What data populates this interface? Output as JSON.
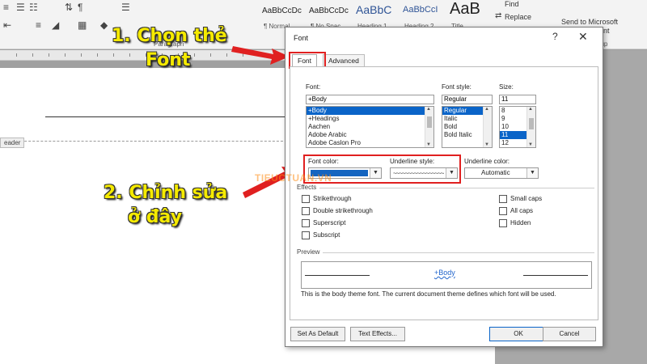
{
  "ribbon": {
    "styles": [
      {
        "sample": "AaBbCcDc",
        "name": "¶ Normal"
      },
      {
        "sample": "AaBbCcDc",
        "name": "¶ No Spac..."
      },
      {
        "sample": "AaBbC",
        "name": "Heading 1"
      },
      {
        "sample": "AaBbCcI",
        "name": "Heading 2"
      },
      {
        "sample": "AaB",
        "name": "Title"
      }
    ],
    "paragraph_label": "Paragraph",
    "find_label": "Find",
    "replace_label": "Replace",
    "send_label": "Send to Microsoft",
    "send_label2": "point",
    "group_label_right": "oup"
  },
  "document": {
    "header_tag": "eader"
  },
  "annotations": {
    "step1_line1": "1. Chọn thẻ",
    "step1_line2": "Font",
    "step2_line1": "2. Chỉnh sửa",
    "step2_line2": "ở đây",
    "watermark": "TIEUCTUAN.VN",
    "arrow_color": "#e02020",
    "text_color": "#f5ea00"
  },
  "dialog": {
    "title": "Font",
    "help": "?",
    "close": "✕",
    "tabs": {
      "font": "Font",
      "advanced": "Advanced"
    },
    "font_label": "Font:",
    "font_value": "+Body",
    "font_list": [
      "+Body",
      "+Headings",
      "Aachen",
      "Adobe Arabic",
      "Adobe Caslon Pro"
    ],
    "font_selected_index": 0,
    "style_label": "Font style:",
    "style_value": "Regular",
    "style_list": [
      "Regular",
      "Italic",
      "Bold",
      "Bold Italic"
    ],
    "style_selected_index": 0,
    "size_label": "Size:",
    "size_value": "11",
    "size_list": [
      "8",
      "9",
      "10",
      "11",
      "12"
    ],
    "size_selected_index": 3,
    "font_color_label": "Font color:",
    "font_color_value": "#1565c0",
    "underline_style_label": "Underline style:",
    "underline_style_value": "~~~~~~~~~~~~~~~~~~~~~",
    "underline_color_label": "Underline color:",
    "underline_color_value": "Automatic",
    "effects_label": "Effects",
    "effects_left": [
      "Strikethrough",
      "Double strikethrough",
      "Superscript",
      "Subscript"
    ],
    "effects_right": [
      "Small caps",
      "All caps",
      "Hidden"
    ],
    "preview_label": "Preview",
    "preview_text": "+Body",
    "description": "This is the body theme font. The current document theme defines which font will be used.",
    "buttons": {
      "set_default": "Set As Default",
      "text_effects": "Text Effects...",
      "ok": "OK",
      "cancel": "Cancel"
    }
  }
}
